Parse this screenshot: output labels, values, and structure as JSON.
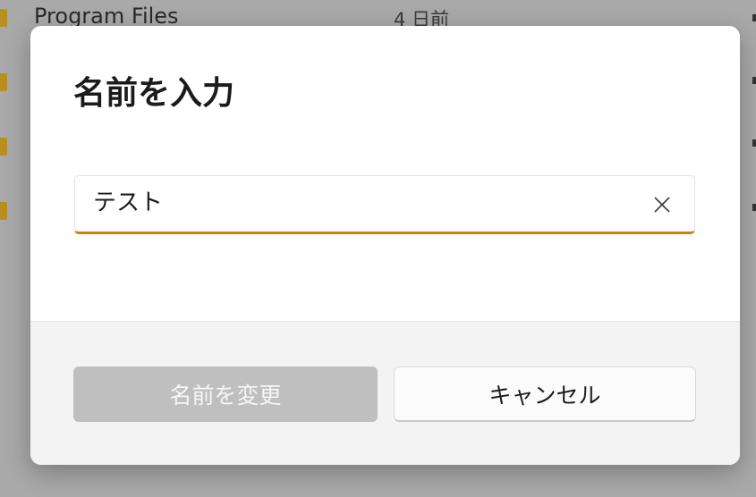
{
  "background_list": {
    "rows": [
      {
        "name": "Program Files",
        "date": "4 日前"
      },
      {
        "name": "",
        "date": ""
      },
      {
        "name": "",
        "date": ""
      },
      {
        "name": "",
        "date": ""
      }
    ]
  },
  "dialog": {
    "title": "名前を入力",
    "input": {
      "value": "テスト",
      "clear_icon": "close-icon"
    },
    "buttons": {
      "rename_label": "名前を変更",
      "cancel_label": "キャンセル"
    }
  },
  "colors": {
    "accent": "#d07f0e",
    "overlay": "#a9a9a9",
    "primary_disabled": "#bfbfbf",
    "folder": "#b8901f"
  }
}
